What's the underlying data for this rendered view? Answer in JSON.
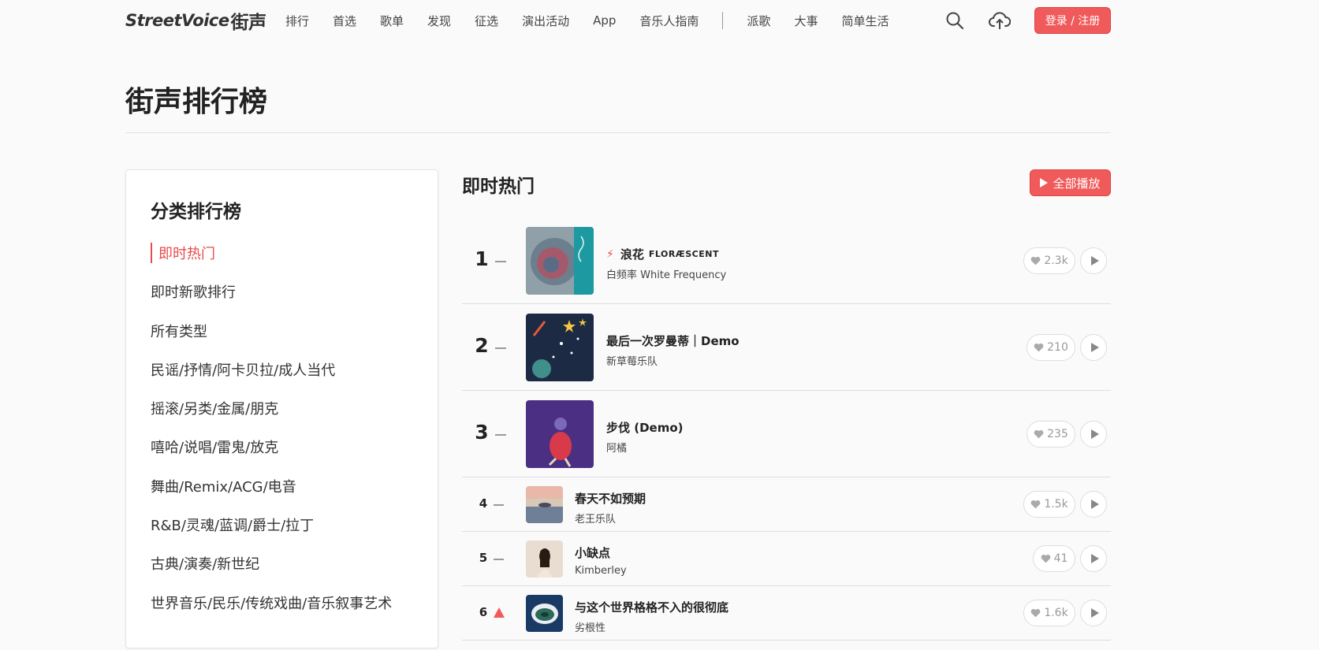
{
  "header": {
    "logo_latin": "StreetVoice",
    "logo_cn": "街声",
    "nav": [
      "排行",
      "首选",
      "歌单",
      "发现",
      "征选",
      "演出活动",
      "App",
      "音乐人指南"
    ],
    "nav_secondary": [
      "派歌",
      "大事",
      "简单生活"
    ],
    "login_label": "登录 / 注册"
  },
  "page": {
    "title": "街声排行榜"
  },
  "sidebar": {
    "title": "分类排行榜",
    "items": [
      {
        "label": "即时热门",
        "active": true
      },
      {
        "label": "即时新歌排行"
      },
      {
        "label": "所有类型"
      },
      {
        "label": "民谣/抒情/阿卡贝拉/成人当代"
      },
      {
        "label": "摇滚/另类/金属/朋克"
      },
      {
        "label": "嘻哈/说唱/雷鬼/放克"
      },
      {
        "label": "舞曲/Remix/ACG/电音"
      },
      {
        "label": "R&B/灵魂/蓝调/爵士/拉丁"
      },
      {
        "label": "古典/演奏/新世纪"
      },
      {
        "label": "世界音乐/民乐/传统戏曲/音乐叙事艺术"
      }
    ]
  },
  "main": {
    "section_title": "即时热门",
    "play_all_label": "全部播放",
    "songs": [
      {
        "rank": "1",
        "trend": "same",
        "title": "浪花",
        "title_sub": "FLORÆSCENT",
        "hot": true,
        "artist": "白频率 White Frequency",
        "likes": "2.3k"
      },
      {
        "rank": "2",
        "trend": "same",
        "title": "最后一次罗曼蒂｜Demo",
        "artist": "新草莓乐队",
        "likes": "210"
      },
      {
        "rank": "3",
        "trend": "same",
        "title": "步伐 (Demo)",
        "artist": "阿橘",
        "likes": "235"
      },
      {
        "rank": "4",
        "trend": "same",
        "title": "春天不如预期",
        "artist": "老王乐队",
        "likes": "1.5k"
      },
      {
        "rank": "5",
        "trend": "same",
        "title": "小缺点",
        "artist": "Kimberley",
        "likes": "41"
      },
      {
        "rank": "6",
        "trend": "up",
        "title": "与这个世界格格不入的很彻底",
        "artist": "劣根性",
        "likes": "1.6k"
      }
    ]
  },
  "colors": {
    "accent": "#f05a5a",
    "text": "#222222",
    "muted": "#999999"
  }
}
